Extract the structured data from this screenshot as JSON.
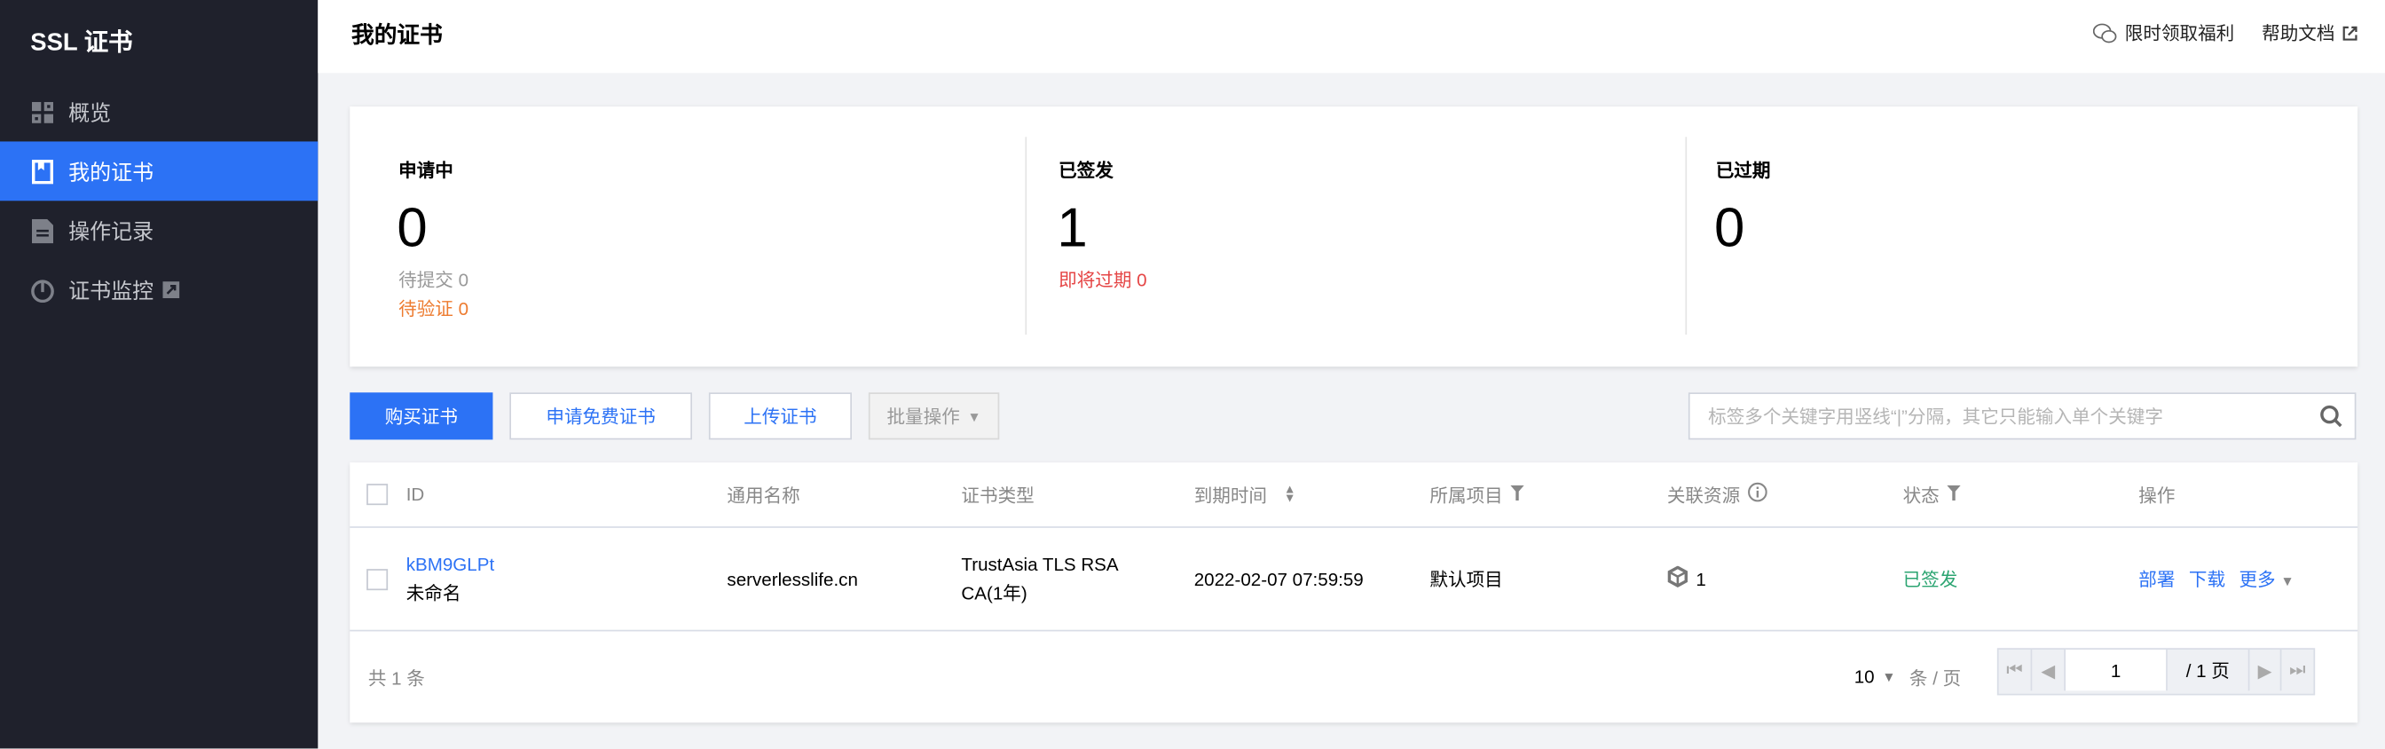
{
  "sidebar": {
    "brand": "SSL 证书",
    "items": [
      {
        "label": "概览",
        "icon": "grid-icon"
      },
      {
        "label": "我的证书",
        "icon": "bookmark-icon",
        "active": true
      },
      {
        "label": "操作记录",
        "icon": "document-icon"
      },
      {
        "label": "证书监控",
        "icon": "monitor-icon",
        "external": true
      }
    ]
  },
  "header": {
    "title": "我的证书",
    "promo": "限时领取福利",
    "help": "帮助文档"
  },
  "stats": {
    "applying": {
      "label": "申请中",
      "count": "0",
      "pending_submit": "待提交 0",
      "pending_verify": "待验证 0"
    },
    "issued": {
      "label": "已签发",
      "count": "1",
      "expiring": "即将过期 0"
    },
    "expired": {
      "label": "已过期",
      "count": "0"
    }
  },
  "toolbar": {
    "buy": "购买证书",
    "free": "申请免费证书",
    "upload": "上传证书",
    "batch": "批量操作",
    "search_placeholder": "标签多个关键字用竖线“|”分隔，其它只能输入单个关键字"
  },
  "table": {
    "columns": [
      "ID",
      "通用名称",
      "证书类型",
      "到期时间",
      "所属项目",
      "关联资源",
      "状态",
      "操作"
    ],
    "rows": [
      {
        "id": "kBM9GLPt",
        "name": "未命名",
        "domain": "serverlesslife.cn",
        "type_line1": "TrustAsia TLS RSA",
        "type_line2": "CA(1年)",
        "expiry": "2022-02-07 07:59:59",
        "project": "默认项目",
        "resources": "1",
        "status": "已签发",
        "actions": {
          "deploy": "部署",
          "download": "下载",
          "more": "更多"
        }
      }
    ],
    "total": "共 1 条",
    "page_size": "10",
    "per_page": "条 / 页",
    "current_page": "1",
    "total_pages": "/ 1 页"
  },
  "colors": {
    "accent": "#2c72f5",
    "sidebar_bg": "#1f212c",
    "warning": "#ed7b2f",
    "danger": "#e54545",
    "success": "#2ba471"
  }
}
